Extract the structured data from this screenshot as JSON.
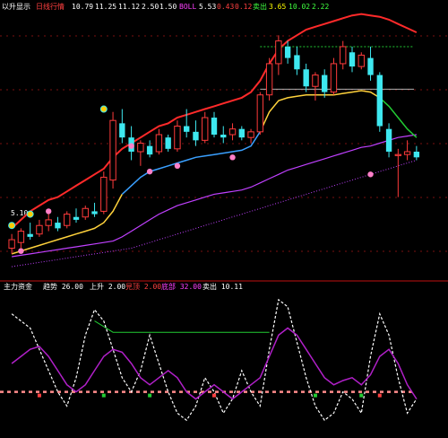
{
  "header": {
    "title": "以升显示",
    "items": [
      {
        "text": "以升显示",
        "color": "#ffffff"
      },
      {
        "text": "日线行情",
        "color": "#ff4040"
      },
      {
        "text": "10.79",
        "color": "#ffffff"
      },
      {
        "text": "11.25",
        "color": "#ffffff"
      },
      {
        "text": "11.12",
        "color": "#ffffff"
      },
      {
        "text": "2.50",
        "color": "#ffffff"
      },
      {
        "text": "1.50",
        "color": "#ffffff"
      },
      {
        "text": "BOLL",
        "color": "#ff40ff"
      },
      {
        "text": "5.53",
        "color": "#ffffff"
      },
      {
        "text": "0.43",
        "color": "#ff4040"
      },
      {
        "text": "0.12",
        "color": "#ff4040"
      },
      {
        "text": "卖出",
        "color": "#40ff40"
      },
      {
        "text": "3.65",
        "color": "#ffff00"
      },
      {
        "text": "10.02",
        "color": "#40ff40"
      },
      {
        "text": "2.22",
        "color": "#40ff40"
      }
    ]
  },
  "price_label": "5.10",
  "sub_header": {
    "items": [
      {
        "text": "主力资金",
        "color": "#ffffff"
      },
      {
        "text": "趋势 26.00",
        "color": "#ffffff"
      },
      {
        "text": "上升 2.00",
        "color": "#ffffff"
      },
      {
        "text": "見顶 2.00",
        "color": "#ff4040"
      },
      {
        "text": "底部 32.00",
        "color": "#ff40ff"
      },
      {
        "text": "卖出 10.11",
        "color": "#ffffff"
      }
    ]
  },
  "colors": {
    "background": "#000000",
    "up": "#ff3b3b",
    "down": "#3ee8f0",
    "upper_band": "#ff2a2a",
    "mid_line": "#ffd23c",
    "mid_line_2": "#3aa0ff",
    "lower_band": "#c040ff",
    "long_ma": "#c040ff",
    "green": "#22cc33",
    "grid": "#7a1010",
    "oscillator_white": "#ffffff",
    "oscillator_purple": "#b020c8",
    "threshold": "#ff8c8c"
  },
  "chart_data": [
    {
      "type": "candlestick",
      "title": "",
      "ylim": [
        4.2,
        13.4
      ],
      "candles": [
        {
          "o": 5.1,
          "h": 5.6,
          "l": 4.9,
          "c": 5.4,
          "dir": "up"
        },
        {
          "o": 5.3,
          "h": 5.8,
          "l": 5.1,
          "c": 5.7,
          "dir": "up"
        },
        {
          "o": 5.6,
          "h": 6.0,
          "l": 5.4,
          "c": 5.5,
          "dir": "down"
        },
        {
          "o": 5.6,
          "h": 6.1,
          "l": 5.5,
          "c": 5.9,
          "dir": "up"
        },
        {
          "o": 5.9,
          "h": 6.3,
          "l": 5.7,
          "c": 6.1,
          "dir": "up"
        },
        {
          "o": 6.0,
          "h": 6.2,
          "l": 5.7,
          "c": 5.8,
          "dir": "down"
        },
        {
          "o": 5.9,
          "h": 6.4,
          "l": 5.8,
          "c": 6.3,
          "dir": "up"
        },
        {
          "o": 6.2,
          "h": 6.5,
          "l": 6.0,
          "c": 6.1,
          "dir": "down"
        },
        {
          "o": 6.2,
          "h": 6.6,
          "l": 6.1,
          "c": 6.5,
          "dir": "up"
        },
        {
          "o": 6.4,
          "h": 6.7,
          "l": 6.2,
          "c": 6.3,
          "dir": "down"
        },
        {
          "o": 6.4,
          "h": 7.8,
          "l": 6.3,
          "c": 7.6,
          "dir": "up"
        },
        {
          "o": 7.5,
          "h": 9.9,
          "l": 7.2,
          "c": 9.6,
          "dir": "up"
        },
        {
          "o": 9.5,
          "h": 10.0,
          "l": 8.8,
          "c": 9.0,
          "dir": "down"
        },
        {
          "o": 9.0,
          "h": 9.4,
          "l": 8.2,
          "c": 8.5,
          "dir": "down"
        },
        {
          "o": 8.5,
          "h": 8.9,
          "l": 8.0,
          "c": 8.8,
          "dir": "up"
        },
        {
          "o": 8.7,
          "h": 8.9,
          "l": 8.3,
          "c": 8.4,
          "dir": "down"
        },
        {
          "o": 8.5,
          "h": 9.3,
          "l": 8.4,
          "c": 9.1,
          "dir": "up"
        },
        {
          "o": 9.0,
          "h": 9.1,
          "l": 8.5,
          "c": 8.6,
          "dir": "down"
        },
        {
          "o": 8.6,
          "h": 9.6,
          "l": 8.5,
          "c": 9.4,
          "dir": "up"
        },
        {
          "o": 9.4,
          "h": 10.0,
          "l": 9.0,
          "c": 9.2,
          "dir": "down"
        },
        {
          "o": 9.2,
          "h": 9.6,
          "l": 8.7,
          "c": 8.9,
          "dir": "down"
        },
        {
          "o": 8.9,
          "h": 9.9,
          "l": 8.8,
          "c": 9.7,
          "dir": "up"
        },
        {
          "o": 9.7,
          "h": 9.9,
          "l": 9.0,
          "c": 9.1,
          "dir": "down"
        },
        {
          "o": 9.1,
          "h": 9.4,
          "l": 8.8,
          "c": 9.0,
          "dir": "down"
        },
        {
          "o": 9.1,
          "h": 9.5,
          "l": 8.9,
          "c": 9.3,
          "dir": "up"
        },
        {
          "o": 9.3,
          "h": 9.4,
          "l": 8.9,
          "c": 9.0,
          "dir": "down"
        },
        {
          "o": 9.0,
          "h": 9.3,
          "l": 8.8,
          "c": 9.2,
          "dir": "up"
        },
        {
          "o": 9.2,
          "h": 10.6,
          "l": 9.1,
          "c": 10.5,
          "dir": "up"
        },
        {
          "o": 10.5,
          "h": 11.8,
          "l": 10.3,
          "c": 11.6,
          "dir": "up"
        },
        {
          "o": 11.6,
          "h": 12.6,
          "l": 11.2,
          "c": 12.4,
          "dir": "up"
        },
        {
          "o": 12.2,
          "h": 12.4,
          "l": 11.6,
          "c": 11.8,
          "dir": "down"
        },
        {
          "o": 11.9,
          "h": 12.2,
          "l": 11.2,
          "c": 11.4,
          "dir": "down"
        },
        {
          "o": 11.4,
          "h": 11.6,
          "l": 10.6,
          "c": 10.8,
          "dir": "down"
        },
        {
          "o": 10.8,
          "h": 11.3,
          "l": 10.3,
          "c": 11.2,
          "dir": "up"
        },
        {
          "o": 11.2,
          "h": 11.4,
          "l": 10.4,
          "c": 10.6,
          "dir": "down"
        },
        {
          "o": 10.6,
          "h": 11.8,
          "l": 10.5,
          "c": 11.6,
          "dir": "up"
        },
        {
          "o": 11.6,
          "h": 12.4,
          "l": 11.4,
          "c": 12.2,
          "dir": "up"
        },
        {
          "o": 12.0,
          "h": 12.2,
          "l": 11.3,
          "c": 11.5,
          "dir": "down"
        },
        {
          "o": 11.5,
          "h": 12.0,
          "l": 11.4,
          "c": 11.9,
          "dir": "up"
        },
        {
          "o": 11.8,
          "h": 12.2,
          "l": 11.0,
          "c": 11.2,
          "dir": "down"
        },
        {
          "o": 11.2,
          "h": 11.3,
          "l": 9.2,
          "c": 9.4,
          "dir": "down"
        },
        {
          "o": 9.3,
          "h": 9.5,
          "l": 8.3,
          "c": 8.5,
          "dir": "down"
        },
        {
          "o": 8.4,
          "h": 8.6,
          "l": 6.9,
          "c": 8.4,
          "dir": "up"
        },
        {
          "o": 8.4,
          "h": 8.9,
          "l": 8.2,
          "c": 8.5,
          "dir": "up"
        },
        {
          "o": 8.5,
          "h": 8.7,
          "l": 8.2,
          "c": 8.3,
          "dir": "down"
        }
      ],
      "upper_band": [
        5.8,
        6.1,
        6.4,
        6.6,
        6.8,
        6.9,
        7.1,
        7.3,
        7.5,
        7.7,
        7.9,
        8.3,
        8.6,
        8.8,
        9.0,
        9.2,
        9.4,
        9.5,
        9.7,
        9.8,
        9.9,
        10.0,
        10.1,
        10.2,
        10.3,
        10.4,
        10.6,
        11.0,
        11.6,
        12.1,
        12.4,
        12.6,
        12.8,
        12.9,
        13.0,
        13.1,
        13.2,
        13.3,
        13.35,
        13.3,
        13.25,
        13.15,
        13.0,
        12.85,
        12.7
      ],
      "mid_line": [
        4.9,
        5.0,
        5.1,
        5.2,
        5.3,
        5.4,
        5.5,
        5.6,
        5.7,
        5.8,
        6.0,
        6.4,
        7.0,
        7.3,
        7.6,
        7.8,
        7.9,
        8.0,
        8.1,
        8.2,
        8.3,
        8.35,
        8.4,
        8.45,
        8.5,
        8.55,
        8.7,
        9.2,
        9.9,
        10.3,
        10.4,
        10.45,
        10.5,
        10.5,
        10.5,
        10.5,
        10.55,
        10.6,
        10.65,
        10.6,
        10.4,
        10.1,
        9.7,
        9.3,
        9.0
      ],
      "lower_band": [
        4.8,
        4.85,
        4.9,
        4.95,
        5.0,
        5.05,
        5.1,
        5.15,
        5.2,
        5.25,
        5.3,
        5.35,
        5.5,
        5.7,
        5.9,
        6.1,
        6.3,
        6.45,
        6.6,
        6.7,
        6.8,
        6.9,
        7.0,
        7.05,
        7.1,
        7.15,
        7.25,
        7.4,
        7.55,
        7.7,
        7.85,
        7.95,
        8.05,
        8.15,
        8.25,
        8.35,
        8.45,
        8.55,
        8.65,
        8.7,
        8.8,
        8.9,
        9.0,
        9.05,
        9.1
      ],
      "long_ma": [
        4.45,
        4.5,
        4.55,
        4.6,
        4.65,
        4.7,
        4.75,
        4.8,
        4.85,
        4.9,
        4.95,
        5.0,
        5.05,
        5.1,
        5.2,
        5.3,
        5.4,
        5.5,
        5.6,
        5.7,
        5.8,
        5.9,
        6.0,
        6.1,
        6.2,
        6.3,
        6.4,
        6.5,
        6.6,
        6.7,
        6.8,
        6.9,
        7.0,
        7.1,
        7.2,
        7.3,
        7.4,
        7.5,
        7.6,
        7.7,
        7.8,
        7.9,
        8.0,
        8.1,
        8.2
      ],
      "horizontal_levels": [
        10.7,
        12.2
      ]
    },
    {
      "type": "line",
      "title": "",
      "ylim": [
        0,
        100
      ],
      "series": [
        {
          "values": [
            85,
            80,
            75,
            60,
            45,
            30,
            20,
            40,
            70,
            88,
            80,
            60,
            40,
            30,
            45,
            70,
            50,
            30,
            15,
            10,
            20,
            40,
            30,
            15,
            25,
            45,
            30,
            20,
            60,
            95,
            90,
            65,
            40,
            20,
            10,
            15,
            30,
            25,
            15,
            55,
            85,
            70,
            40,
            15,
            25
          ]
        },
        {
          "values": [
            50,
            55,
            60,
            62,
            55,
            45,
            35,
            30,
            35,
            45,
            55,
            60,
            58,
            50,
            40,
            35,
            40,
            45,
            40,
            30,
            25,
            30,
            35,
            30,
            25,
            30,
            35,
            40,
            55,
            70,
            75,
            70,
            60,
            50,
            40,
            35,
            38,
            40,
            35,
            42,
            55,
            60,
            50,
            35,
            25
          ]
        }
      ],
      "threshold": 30,
      "upper_line": 80
    }
  ]
}
